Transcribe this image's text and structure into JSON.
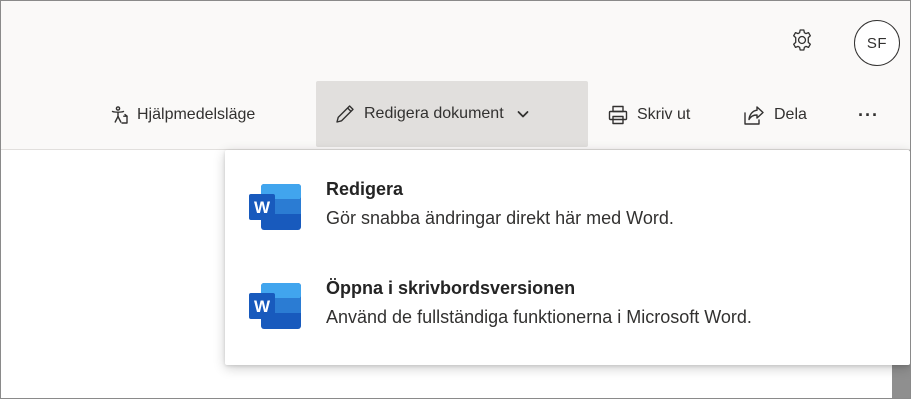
{
  "profile": {
    "initials": "SF"
  },
  "toolbar": {
    "accessibility_label": "Hjälpmedelsläge",
    "edit_label": "Redigera dokument",
    "print_label": "Skriv ut",
    "share_label": "Dela",
    "more_label": "···"
  },
  "dropdown": {
    "items": [
      {
        "title": "Redigera",
        "description": "Gör snabba ändringar direkt här med Word.",
        "icon": "word-icon"
      },
      {
        "title": "Öppna i skrivbordsversionen",
        "description": "Använd de fullständiga funktionerna i Microsoft Word.",
        "icon": "word-icon"
      }
    ]
  },
  "colors": {
    "toolbar_background": "#faf9f8",
    "selected_button": "#e1dfdd",
    "word_dark": "#185abd",
    "word_mid": "#2b7cd3",
    "word_light": "#41a5ee"
  }
}
